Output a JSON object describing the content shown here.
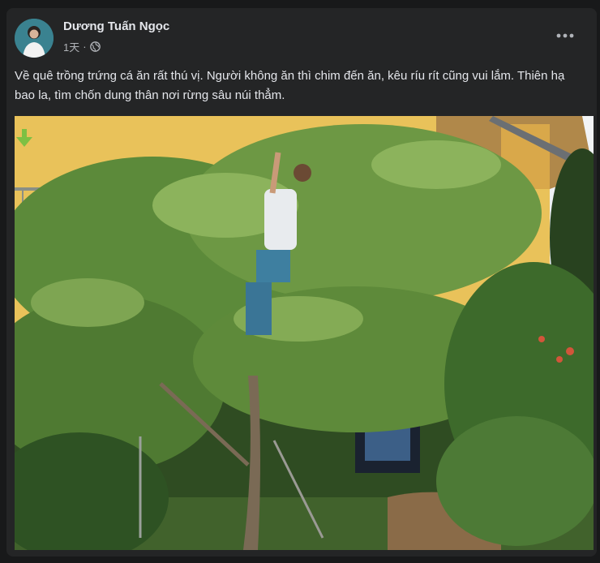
{
  "post": {
    "author": "Dương Tuấn Ngọc",
    "time": "1天",
    "separator": "·",
    "privacy_icon": "globe-icon",
    "more_icon": "more-horizontal-icon",
    "text": "Về quê trồng trứng cá ăn rất thú vị. Người không ăn thì chim đến ăn, kêu ríu rít cũng vui lắm. Thiên hạ bao la, tìm chốn dung thân nơi rừng sâu núi thẳm."
  },
  "photo": {
    "description_icon": "download-arrow-icon"
  },
  "colors": {
    "page_bg": "#18191a",
    "card_bg": "#242526",
    "text_primary": "#e4e6eb",
    "text_secondary": "#b0b3b8"
  }
}
